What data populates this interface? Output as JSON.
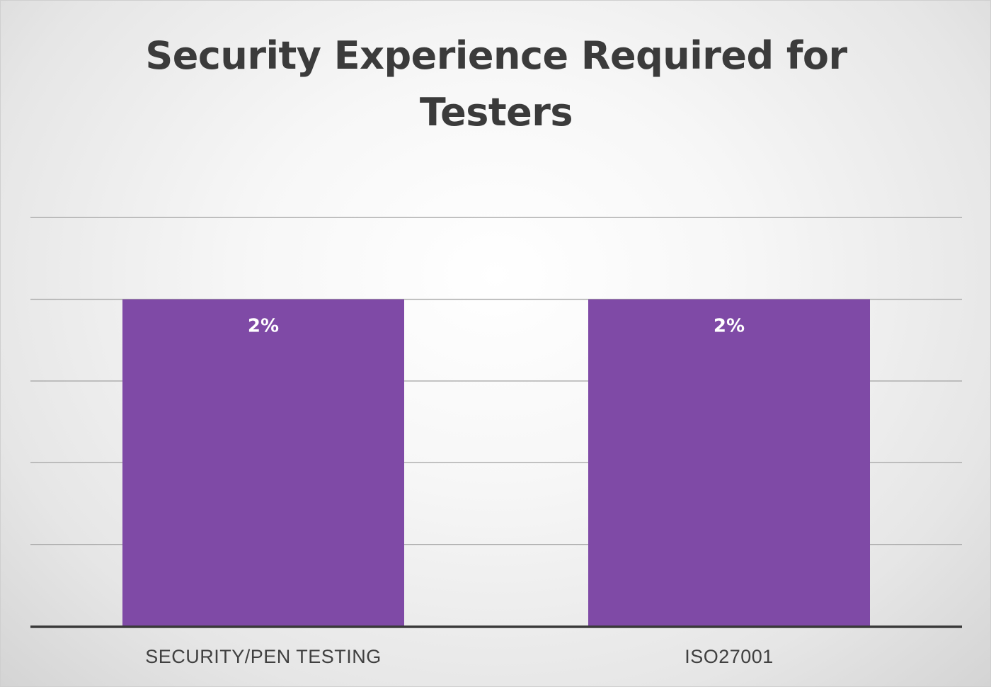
{
  "chart_data": {
    "type": "bar",
    "title": "Security Experience Required for Testers",
    "title_lines": [
      "Security Experience Required for",
      "Testers"
    ],
    "categories": [
      "SECURITY/PEN TESTING",
      "ISO27001"
    ],
    "values": [
      2,
      2
    ],
    "data_labels": [
      "2%",
      "2%"
    ],
    "unit": "%",
    "xlabel": "",
    "ylabel": "",
    "ylim": [
      0,
      2.8
    ],
    "grid": true,
    "legend": "none",
    "bar_color": "#7f4aa6"
  }
}
